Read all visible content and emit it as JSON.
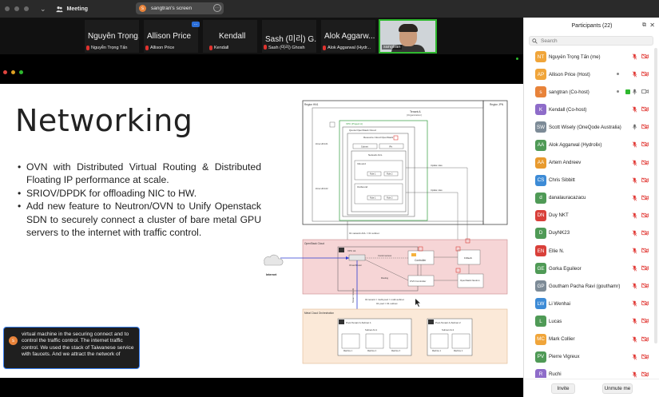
{
  "titlebar": {
    "meeting_label": "Meeting",
    "share_label": "sangtran's screen",
    "share_avatar": "s"
  },
  "video_strip": {
    "tiles": [
      {
        "big": "Nguyễn Trọng...",
        "small": "Nguyễn Trọng Tấn"
      },
      {
        "big": "Allison Price",
        "small": "Allison Price"
      },
      {
        "big": "Kendall",
        "small": "Kendall"
      },
      {
        "big": "Sash (미리) G...",
        "small": "Sash (미리) Ghosh"
      },
      {
        "big": "Alok Aggarw...",
        "small": "Alok Aggarwal (Hydr..."
      },
      {
        "small": "sangtran"
      }
    ],
    "more_label": "···"
  },
  "slide": {
    "title": "Networking",
    "bullets": [
      "OVN with Distributed Virtual Routing & Distributed Floating IP performance at scale.",
      "SRIOV/DPDK for offloading NIC to HW.",
      "Add new feature to Neutron/OVN to Unify Openstack SDN to securely connect a cluster of bare metal GPU servers to the internet with traffic control."
    ]
  },
  "diagram": {
    "region_left": "Region HN1",
    "region_right": "Region JPN",
    "tenant_title": "Tenant A",
    "tenant_sub": "(Organization)",
    "vpc_label": "VPC (Project A)",
    "quota_label": "Quota OpenStack Cloud",
    "resource_label": "Resource Cloud OpenStack",
    "subnet_label": "Subnet",
    "ips_label": "IPs",
    "acl_label": "Network ACL",
    "inbound_label": "Inbound",
    "outbound_label": "Outbound",
    "rule1": "Rule 1",
    "rule2": "Rule 2",
    "zone1": "Zone HN1-01",
    "zone2": "Zone HN1-02",
    "update_rules": "Update rules",
    "net_acl_subnet": "01 network ACL = 01 subnet",
    "openstack_cloud": "OpenStack Cloud",
    "vpc_a1": "VPC A1",
    "virtual_router": "Virtual Router",
    "control_access": "Control access",
    "routing": "Routing",
    "controller": "Controller",
    "firewall": "FWaaS",
    "ovn_controller": "OVN Controller",
    "openstack_neutron": "OpenStack Neutron",
    "internet": "Internet",
    "tenant_network": "Tenant Network",
    "tenant_pool_1": "01 tenant = multi-pool = multi-subnet",
    "tenant_pool_2": "01 pool = 01 subnet",
    "metal_cloud": "Metal Cloud Orchestration",
    "pool1": "Pool-Tenant A-Subnet 1",
    "pool2": "Pool-Tenant A-Subnet 2",
    "subnet_a11": "Subnet A1.1",
    "subnet_a12": "Subnet A1.2",
    "machine1": "Machine 1",
    "machine2": "Machine 2",
    "machine3": "Machine 3"
  },
  "caption": {
    "avatar": "s",
    "text": "virtual machine in the securing connect and to control the traffic control. The internet traffic control. We used the stack of Taiwanese service with faucets. And we attract the network of"
  },
  "participants": {
    "title": "Participants (22)",
    "search_placeholder": "Search",
    "invite_label": "Invite",
    "unmute_label": "Unmute me",
    "list": [
      {
        "initials": "NT",
        "name": "Nguyễn Trọng Tấn (me)",
        "color": "#f0a53a",
        "muted": true,
        "cam_off": true,
        "dots": false,
        "share": false
      },
      {
        "initials": "AP",
        "name": "Allison Price (Host)",
        "color": "#f0a53a",
        "muted": true,
        "cam_off": true,
        "dots": true,
        "share": false
      },
      {
        "initials": "s",
        "name": "sangtran (Co-host)",
        "color": "#e8833a",
        "muted": false,
        "cam_off": false,
        "dots": true,
        "share": true
      },
      {
        "initials": "K",
        "name": "Kendall (Co-host)",
        "color": "#8e6cc9",
        "muted": true,
        "cam_off": true,
        "dots": false,
        "share": false
      },
      {
        "initials": "SW",
        "name": "Scott Wisely (OneQode Australia)",
        "color": "#7d8b97",
        "muted": false,
        "cam_off": true,
        "dots": false,
        "share": false
      },
      {
        "initials": "AA",
        "name": "Alok Aggarwal (Hydrolix)",
        "color": "#4f9a56",
        "muted": true,
        "cam_off": true,
        "dots": false,
        "share": false
      },
      {
        "initials": "AA",
        "name": "Artem Andreev",
        "color": "#e89a2e",
        "muted": true,
        "cam_off": true,
        "dots": false,
        "share": false
      },
      {
        "initials": "CS",
        "name": "Chris Sibbitt",
        "color": "#3d8bd6",
        "muted": true,
        "cam_off": true,
        "dots": false,
        "share": false
      },
      {
        "initials": "d",
        "name": "danalauracazacu",
        "color": "#4f9a56",
        "muted": true,
        "cam_off": true,
        "dots": false,
        "share": false
      },
      {
        "initials": "DN",
        "name": "Duy NKT",
        "color": "#d9403a",
        "muted": true,
        "cam_off": true,
        "dots": false,
        "share": false
      },
      {
        "initials": "D",
        "name": "DuyNK23",
        "color": "#4f9a56",
        "muted": true,
        "cam_off": true,
        "dots": false,
        "share": false
      },
      {
        "initials": "EN",
        "name": "Ellie N.",
        "color": "#d9403a",
        "muted": true,
        "cam_off": true,
        "dots": false,
        "share": false
      },
      {
        "initials": "GE",
        "name": "Gorka Eguileor",
        "color": "#4f9a56",
        "muted": true,
        "cam_off": true,
        "dots": false,
        "share": false
      },
      {
        "initials": "GP",
        "name": "Goutham Pacha Ravi (gouthamr)",
        "color": "#7d8b97",
        "muted": true,
        "cam_off": true,
        "dots": false,
        "share": false
      },
      {
        "initials": "LW",
        "name": "Li Wenhai",
        "color": "#3d8bd6",
        "muted": true,
        "cam_off": true,
        "dots": false,
        "share": false
      },
      {
        "initials": "L",
        "name": "Lucas",
        "color": "#4f9a56",
        "muted": true,
        "cam_off": true,
        "dots": false,
        "share": false
      },
      {
        "initials": "MC",
        "name": "Mark Collier",
        "color": "#f0a53a",
        "muted": true,
        "cam_off": true,
        "dots": false,
        "share": false
      },
      {
        "initials": "PV",
        "name": "Pierre Vigreux",
        "color": "#4f9a56",
        "muted": true,
        "cam_off": true,
        "dots": false,
        "share": false
      },
      {
        "initials": "R",
        "name": "Ruchi",
        "color": "#8e6cc9",
        "muted": true,
        "cam_off": true,
        "dots": false,
        "share": false
      }
    ]
  },
  "colors": {
    "mic_muted": "#e0332f",
    "accent_blue": "#3b82f6",
    "video_border": "#2eb82e"
  }
}
